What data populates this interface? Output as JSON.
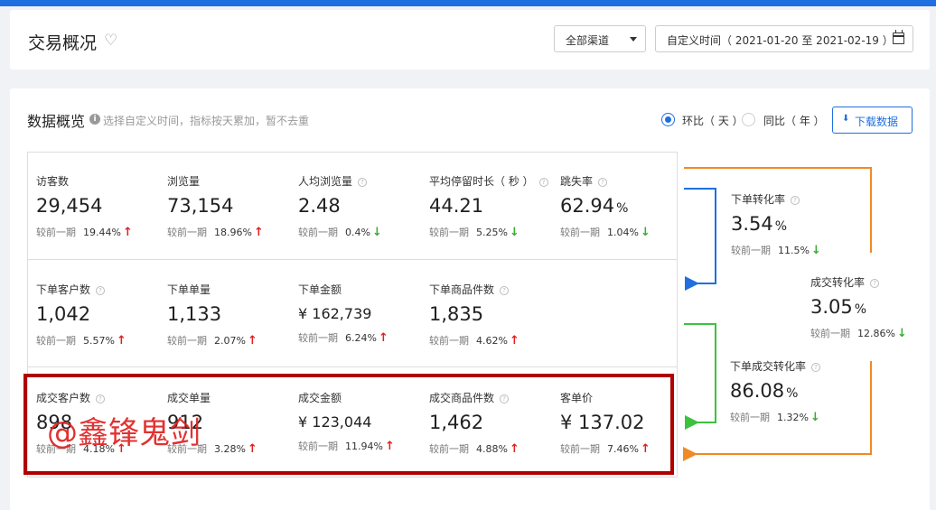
{
  "header": {
    "title": "交易概况",
    "channel_select": "全部渠道",
    "date_range": "自定义时间（ 2021-01-20 至 2021-02-19 ）"
  },
  "overview": {
    "title": "数据概览",
    "hint": "选择自定义时间，指标按天累加，暂不去重",
    "radio_daily": "环比（ 天 ）",
    "radio_yearly": "同比（ 年 ）",
    "download_label": "下载数据"
  },
  "compare_label": "较前一期",
  "metrics": {
    "visitors": {
      "label": "访客数",
      "value": "29,454",
      "unit": "",
      "pct": "19.44%",
      "dir": "up"
    },
    "pageviews": {
      "label": "浏览量",
      "value": "73,154",
      "unit": "",
      "pct": "18.96%",
      "dir": "up"
    },
    "per_capita_pv": {
      "label": "人均浏览量",
      "value": "2.48",
      "unit": "",
      "pct": "0.4%",
      "dir": "down"
    },
    "avg_stay": {
      "label": "平均停留时长（ 秒 ）",
      "value": "44.21",
      "unit": "",
      "pct": "5.25%",
      "dir": "down"
    },
    "bounce_rate": {
      "label": "跳失率",
      "value": "62.94",
      "unit": "%",
      "pct": "1.04%",
      "dir": "down"
    },
    "order_customers": {
      "label": "下单客户数",
      "value": "1,042",
      "unit": "",
      "pct": "5.57%",
      "dir": "up"
    },
    "order_count": {
      "label": "下单单量",
      "value": "1,133",
      "unit": "",
      "pct": "2.07%",
      "dir": "up"
    },
    "order_amount": {
      "label": "下单金额",
      "value": "¥ 162,739",
      "unit": "",
      "pct": "6.24%",
      "dir": "up"
    },
    "order_items": {
      "label": "下单商品件数",
      "value": "1,835",
      "unit": "",
      "pct": "4.62%",
      "dir": "up"
    },
    "deal_customers": {
      "label": "成交客户数",
      "value": "898",
      "unit": "",
      "pct": "4.18%",
      "dir": "up"
    },
    "deal_count": {
      "label": "成交单量",
      "value": "912",
      "unit": "",
      "pct": "3.28%",
      "dir": "up"
    },
    "deal_amount": {
      "label": "成交金额",
      "value": "¥ 123,044",
      "unit": "",
      "pct": "11.94%",
      "dir": "up"
    },
    "deal_items": {
      "label": "成交商品件数",
      "value": "1,462",
      "unit": "",
      "pct": "4.88%",
      "dir": "up"
    },
    "avg_order_value": {
      "label": "客单价",
      "value": "¥ 137.02",
      "unit": "",
      "pct": "7.46%",
      "dir": "up"
    }
  },
  "funnel": {
    "order_conversion": {
      "label": "下单转化率",
      "value": "3.54",
      "unit": "%",
      "pct": "11.5%",
      "dir": "down"
    },
    "deal_conversion": {
      "label": "成交转化率",
      "value": "3.05",
      "unit": "%",
      "pct": "12.86%",
      "dir": "down"
    },
    "order_deal_conversion": {
      "label": "下单成交转化率",
      "value": "86.08",
      "unit": "%",
      "pct": "1.32%",
      "dir": "down"
    }
  },
  "watermark": "@鑫锋鬼剑",
  "colors": {
    "primary": "#1f6fe0",
    "up_arrow": "#e02020",
    "down_arrow": "#3aaa35",
    "flow_orange": "#f08a24",
    "flow_blue": "#1f6fe0",
    "flow_green": "#3cc23c",
    "highlight_border": "#b00000"
  }
}
